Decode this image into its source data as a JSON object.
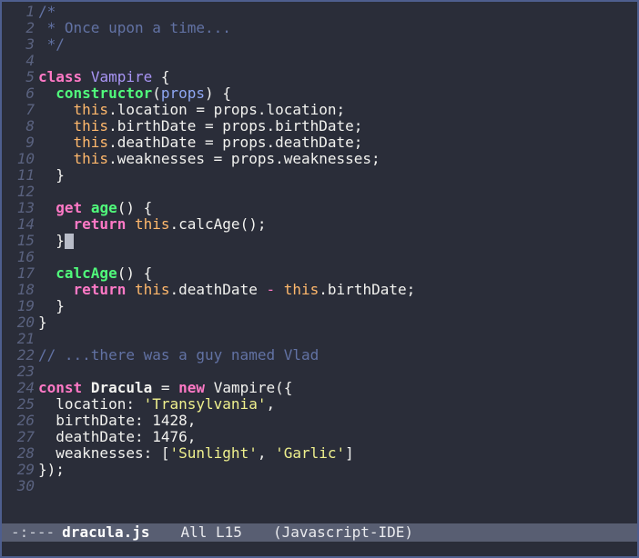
{
  "colors": {
    "background": "#2a2d39",
    "foreground": "#f2f2ef",
    "border": "#4e5e8e",
    "comment": "#6272a4",
    "keyword_pink": "#ff79c6",
    "function_green": "#50fa7b",
    "param_blue": "#8fa7f3",
    "type_purple": "#a995f5",
    "this_orange": "#ffb86c",
    "string_yellow": "#eff08d",
    "line_number": "#5a627f",
    "cursor": "#b8bcc8",
    "modeline_bg": "#585e72",
    "modeline_fg": "#e9eaee",
    "modeline_dim": "#cfd2da",
    "modeline_file": "#ffffff"
  },
  "code": {
    "cursor_line": 15,
    "lines": [
      {
        "n": "1",
        "tokens": [
          [
            "comment",
            "/*"
          ]
        ]
      },
      {
        "n": "2",
        "tokens": [
          [
            "comment",
            " * Once upon a time..."
          ]
        ]
      },
      {
        "n": "3",
        "tokens": [
          [
            "comment",
            " */"
          ]
        ]
      },
      {
        "n": "4",
        "tokens": []
      },
      {
        "n": "5",
        "tokens": [
          [
            "keyword",
            "class"
          ],
          [
            "fg",
            " "
          ],
          [
            "type",
            "Vampire"
          ],
          [
            "fg",
            " {"
          ]
        ]
      },
      {
        "n": "6",
        "tokens": [
          [
            "fg",
            "  "
          ],
          [
            "func",
            "constructor"
          ],
          [
            "fg",
            "("
          ],
          [
            "param",
            "props"
          ],
          [
            "fg",
            ") {"
          ]
        ]
      },
      {
        "n": "7",
        "tokens": [
          [
            "fg",
            "    "
          ],
          [
            "self",
            "this"
          ],
          [
            "fg",
            ".location = props.location;"
          ]
        ]
      },
      {
        "n": "8",
        "tokens": [
          [
            "fg",
            "    "
          ],
          [
            "self",
            "this"
          ],
          [
            "fg",
            ".birthDate = props.birthDate;"
          ]
        ]
      },
      {
        "n": "9",
        "tokens": [
          [
            "fg",
            "    "
          ],
          [
            "self",
            "this"
          ],
          [
            "fg",
            ".deathDate = props.deathDate;"
          ]
        ]
      },
      {
        "n": "10",
        "tokens": [
          [
            "fg",
            "    "
          ],
          [
            "self",
            "this"
          ],
          [
            "fg",
            ".weaknesses = props.weaknesses;"
          ]
        ]
      },
      {
        "n": "11",
        "tokens": [
          [
            "fg",
            "  }"
          ]
        ]
      },
      {
        "n": "12",
        "tokens": []
      },
      {
        "n": "13",
        "tokens": [
          [
            "fg",
            "  "
          ],
          [
            "keyword",
            "get"
          ],
          [
            "fg",
            " "
          ],
          [
            "func",
            "age"
          ],
          [
            "fg",
            "() {"
          ]
        ]
      },
      {
        "n": "14",
        "tokens": [
          [
            "fg",
            "    "
          ],
          [
            "keyword",
            "return"
          ],
          [
            "fg",
            " "
          ],
          [
            "self",
            "this"
          ],
          [
            "fg",
            ".calcAge();"
          ]
        ]
      },
      {
        "n": "15",
        "tokens": [
          [
            "fg",
            "  }"
          ]
        ],
        "cursor": true
      },
      {
        "n": "16",
        "tokens": []
      },
      {
        "n": "17",
        "tokens": [
          [
            "fg",
            "  "
          ],
          [
            "func",
            "calcAge"
          ],
          [
            "fg",
            "() {"
          ]
        ]
      },
      {
        "n": "18",
        "tokens": [
          [
            "fg",
            "    "
          ],
          [
            "keyword",
            "return"
          ],
          [
            "fg",
            " "
          ],
          [
            "self",
            "this"
          ],
          [
            "fg",
            ".deathDate "
          ],
          [
            "op",
            "-"
          ],
          [
            "fg",
            " "
          ],
          [
            "self",
            "this"
          ],
          [
            "fg",
            ".birthDate;"
          ]
        ]
      },
      {
        "n": "19",
        "tokens": [
          [
            "fg",
            "  }"
          ]
        ]
      },
      {
        "n": "20",
        "tokens": [
          [
            "fg",
            "}"
          ]
        ]
      },
      {
        "n": "21",
        "tokens": []
      },
      {
        "n": "22",
        "tokens": [
          [
            "comment",
            "// ...there was a guy named Vlad"
          ]
        ]
      },
      {
        "n": "23",
        "tokens": []
      },
      {
        "n": "24",
        "tokens": [
          [
            "keyword",
            "const"
          ],
          [
            "fg",
            " "
          ],
          [
            "bold",
            "Dracula"
          ],
          [
            "fg",
            " = "
          ],
          [
            "keyword",
            "new"
          ],
          [
            "fg",
            " Vampire({"
          ]
        ]
      },
      {
        "n": "25",
        "tokens": [
          [
            "fg",
            "  location: "
          ],
          [
            "str",
            "'Transylvania'"
          ],
          [
            "fg",
            ","
          ]
        ]
      },
      {
        "n": "26",
        "tokens": [
          [
            "fg",
            "  birthDate: 1428,"
          ]
        ]
      },
      {
        "n": "27",
        "tokens": [
          [
            "fg",
            "  deathDate: 1476,"
          ]
        ]
      },
      {
        "n": "28",
        "tokens": [
          [
            "fg",
            "  weaknesses: ["
          ],
          [
            "str",
            "'Sunlight'"
          ],
          [
            "fg",
            ", "
          ],
          [
            "str",
            "'Garlic'"
          ],
          [
            "fg",
            "]"
          ]
        ]
      },
      {
        "n": "29",
        "tokens": [
          [
            "fg",
            "});"
          ]
        ]
      },
      {
        "n": "30",
        "tokens": []
      }
    ]
  },
  "modeline": {
    "status": "-:---",
    "filename": "dracula.js",
    "position": "All L15",
    "mode_name": "(Javascript-IDE)"
  }
}
